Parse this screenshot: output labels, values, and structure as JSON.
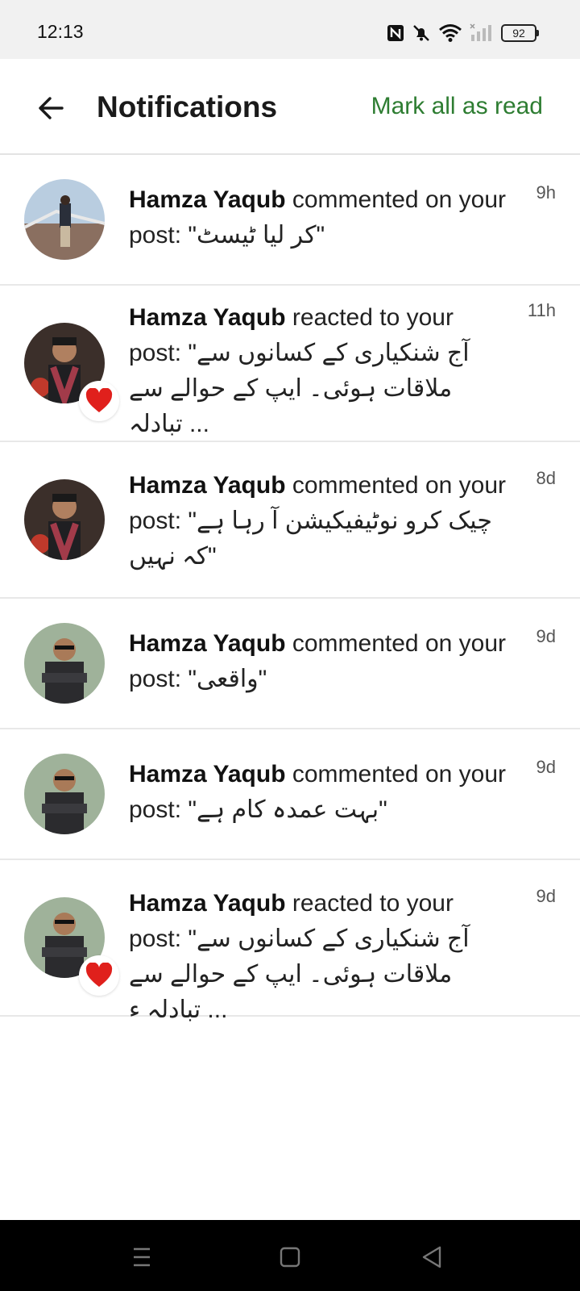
{
  "status_bar": {
    "time": "12:13",
    "battery": "92",
    "icons": [
      "nfc-icon",
      "mute-icon",
      "wifi-icon",
      "signal-icon",
      "battery-icon"
    ]
  },
  "header": {
    "title": "Notifications",
    "mark_all_label": "Mark all as read",
    "accent_color": "#2e7d32"
  },
  "notifications": [
    {
      "name": "Hamza Yaqub",
      "action": " commented on your post: \"کر لیا ٹیسٹ\"",
      "time": "9h",
      "reaction": ""
    },
    {
      "name": "Hamza Yaqub",
      "action": " reacted to your post: \"آج شنکیاری کے کسانوں سے ملاقات ہوئی۔ ایپ کے حوالے سے تبادلہ ...",
      "time": "11h",
      "reaction": "heart-icon"
    },
    {
      "name": "Hamza Yaqub",
      "action": " commented on your post: \"چیک کرو نوٹیفیکیشن آ رہا ہے کہ نہیں\"",
      "time": "8d",
      "reaction": ""
    },
    {
      "name": "Hamza Yaqub",
      "action": " commented on your post: \"واقعی\"",
      "time": "9d",
      "reaction": ""
    },
    {
      "name": "Hamza Yaqub",
      "action": " commented on your post: \"بہت عمدہ کام ہے\"",
      "time": "9d",
      "reaction": ""
    },
    {
      "name": "Hamza Yaqub",
      "action": " reacted to your post: \"آج شنکیاری کے کسانوں سے ملاقات ہوئی۔ ایپ کے حوالے سے تبادلہ ء ...",
      "time": "9d",
      "reaction": "heart-icon"
    }
  ],
  "nav_bar": {
    "icons": [
      "menu-icon",
      "home-square-icon",
      "back-triangle-icon"
    ]
  }
}
